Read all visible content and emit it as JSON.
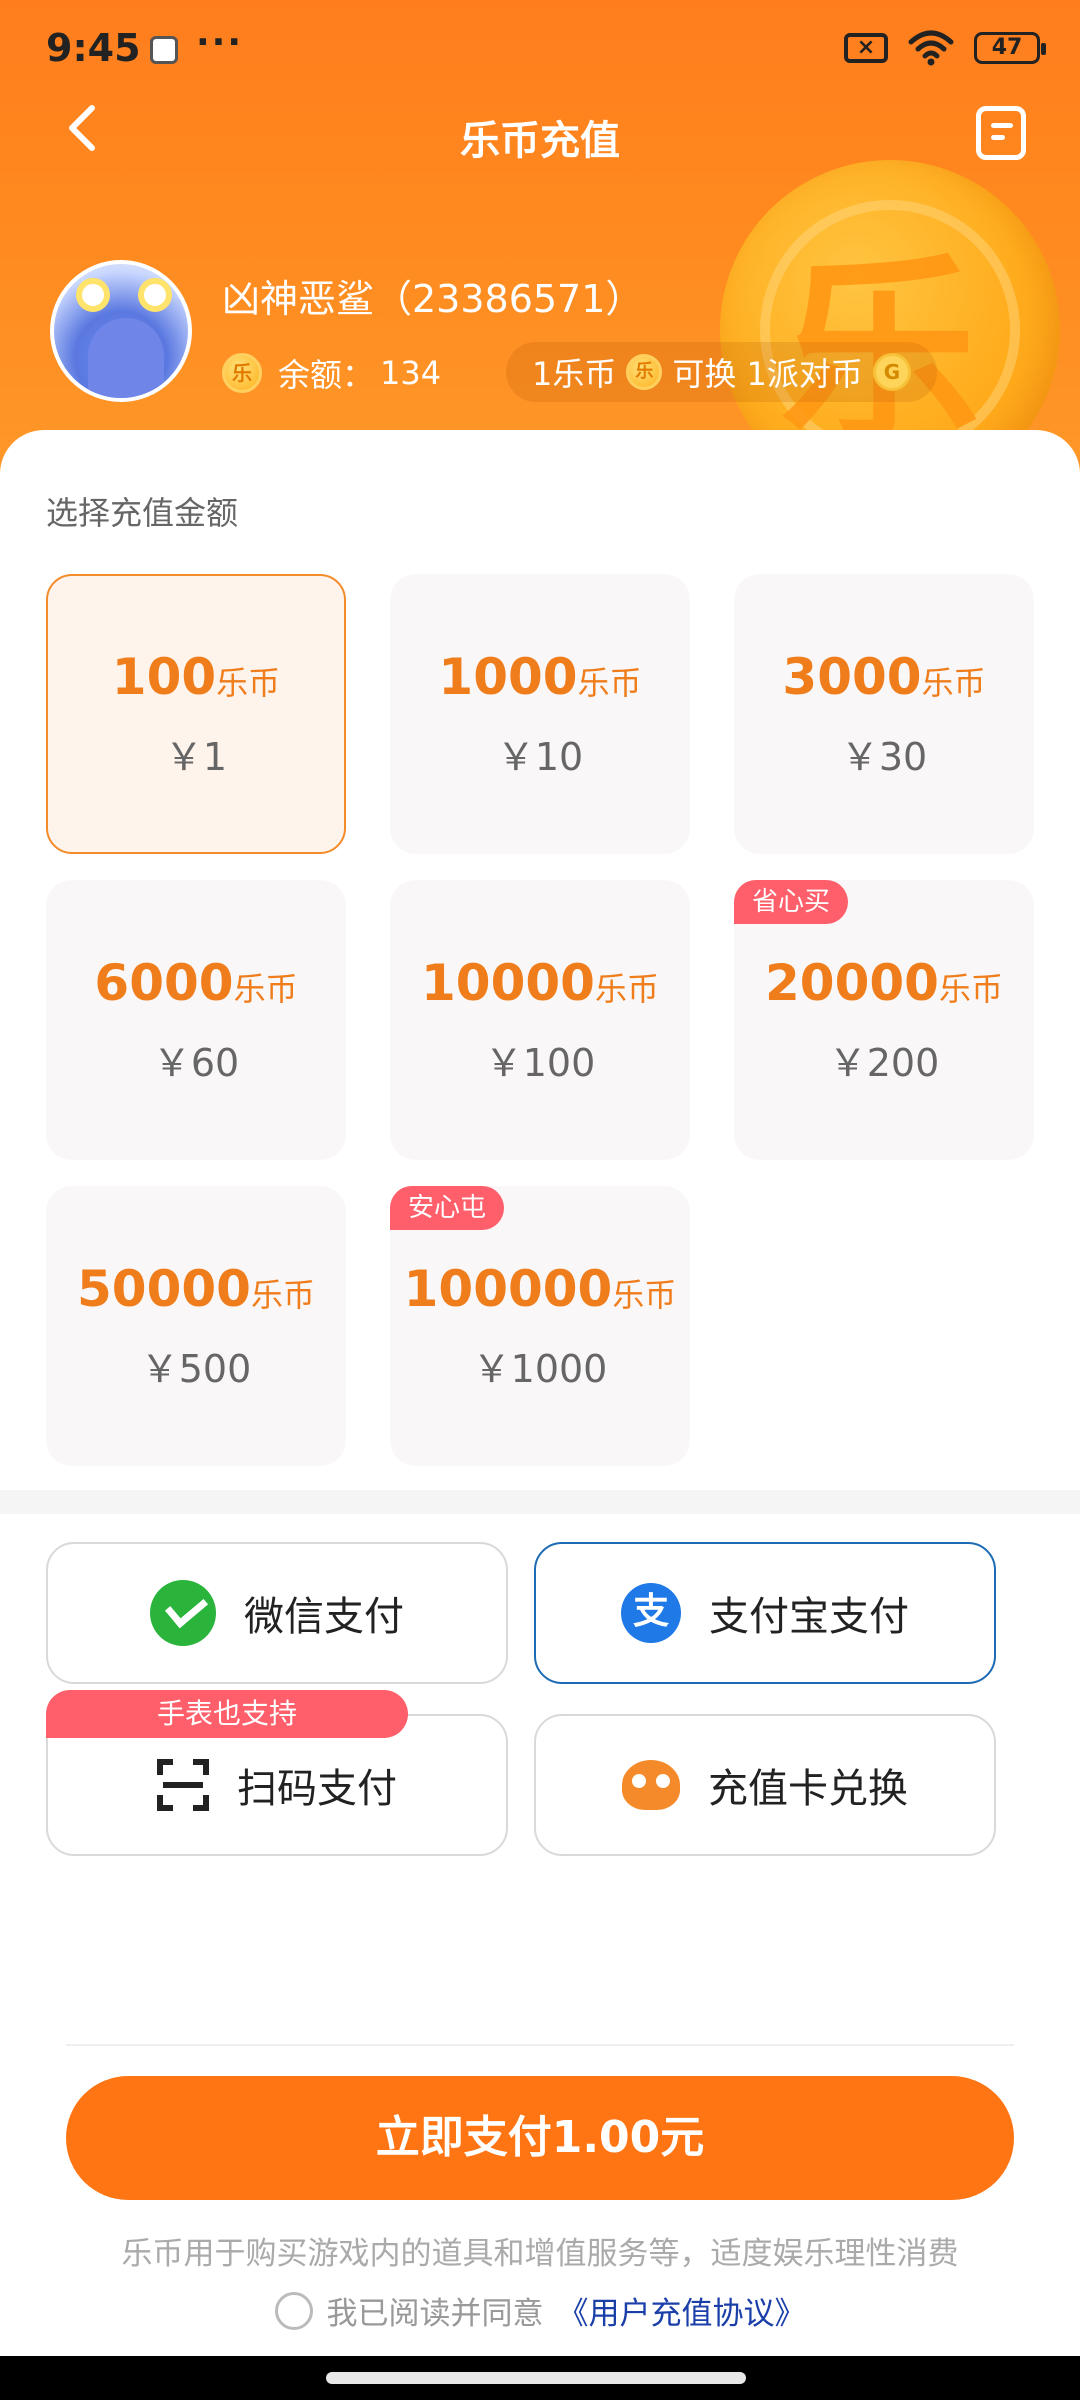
{
  "status_bar": {
    "time": "9:45",
    "dots": "···",
    "battery": "47",
    "icons": [
      "notification-app-icon",
      "sim-disabled-icon",
      "wifi-icon",
      "battery-icon"
    ]
  },
  "nav": {
    "title": "乐币充值",
    "back_icon": "chevron-left-icon",
    "menu_icon": "order-list-icon"
  },
  "user": {
    "name": "凶神恶鲨（23386571）",
    "balance_label": "余额：",
    "balance_value": "134",
    "coin_glyph": "乐",
    "exchange_prefix": "1乐币",
    "exchange_suffix": "可换 1派对币",
    "party_coin_glyph": "G"
  },
  "amount": {
    "section_title": "选择充值金额",
    "unit": "乐币",
    "options": [
      {
        "coins": "100",
        "price": "￥1",
        "selected": true,
        "tag": ""
      },
      {
        "coins": "1000",
        "price": "￥10",
        "selected": false,
        "tag": ""
      },
      {
        "coins": "3000",
        "price": "￥30",
        "selected": false,
        "tag": ""
      },
      {
        "coins": "6000",
        "price": "￥60",
        "selected": false,
        "tag": ""
      },
      {
        "coins": "10000",
        "price": "￥100",
        "selected": false,
        "tag": ""
      },
      {
        "coins": "20000",
        "price": "￥200",
        "selected": false,
        "tag": "省心买"
      },
      {
        "coins": "50000",
        "price": "￥500",
        "selected": false,
        "tag": ""
      },
      {
        "coins": "100000",
        "price": "￥1000",
        "selected": false,
        "tag": "安心屯"
      }
    ]
  },
  "payment": {
    "wechat": "微信支付",
    "alipay": "支付宝支付",
    "alipay_glyph": "支",
    "scan": "扫码支付",
    "scan_tag": "手表也支持",
    "card": "充值卡兑换",
    "selected": "alipay",
    "accent_color": "#1c6bb5"
  },
  "footer": {
    "pay_button": "立即支付1.00元",
    "notice": "乐币用于购买游戏内的道具和增值服务等，适度娱乐理性消费",
    "agree_text": "我已阅读并同意",
    "agree_link": "《用户充值协议》"
  },
  "colors": {
    "brand_orange": "#ff7413",
    "price_orange": "#ef7d1b",
    "tag_red": "#ff5f6a"
  }
}
